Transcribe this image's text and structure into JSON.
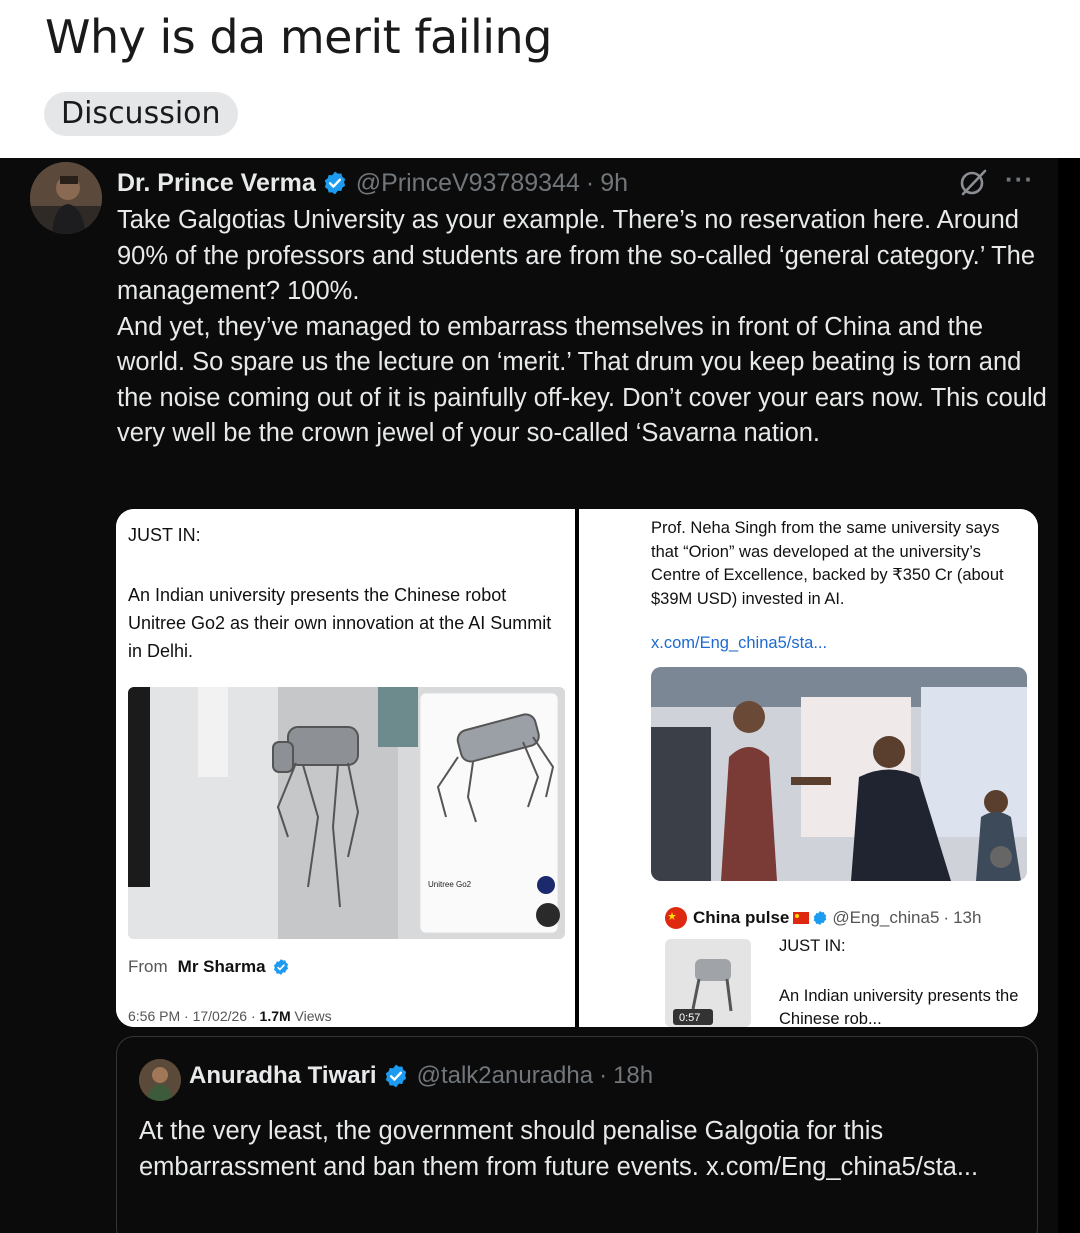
{
  "post": {
    "title": "Why is da merit failing",
    "flair": "Discussion"
  },
  "tweet": {
    "author_name": "Dr. Prince Verma",
    "handle": "@PrinceV93789344",
    "separator": "·",
    "time": "9h",
    "more_label": "···",
    "text_lines": [
      "Take Galgotias University as your example. There’s no reservation here. Around 90% of the professors and students are from the so-called ‘general category.’ The management? 100%.",
      "And yet, they’ve managed to embarrass themselves in front of China and the world. So spare us the lecture on ‘merit.’ That drum you keep beating is torn and the noise coming out of it is painfully off-key. Don’t cover your ears now. This could very well be the crown jewel of your so-called ‘Savarna nation."
    ]
  },
  "media_left": {
    "heading": "JUST IN:",
    "body": "An Indian university presents the Chinese robot Unitree Go2 as their own innovation at the AI Summit in Delhi.",
    "product_label": "Unitree Go2",
    "from_label": "From",
    "from_name": "Mr Sharma",
    "stats_time": "6:56 PM · 17/02/26 · ",
    "stats_views": "1.7M",
    "stats_views_label": " Views"
  },
  "media_right": {
    "body": "Prof. Neha Singh from the same university says that “Orion” was developed at the university’s Centre of Excellence, backed by ₹350 Cr (about $39M USD) invested in AI.",
    "link": "x.com/Eng_china5/sta...",
    "card_name": "China pulse",
    "card_handle": "@Eng_china5",
    "card_sep": "·",
    "card_time": "13h",
    "card_heading": "JUST IN:",
    "card_text": "An Indian university presents the Chinese rob...",
    "video_time": "0:57"
  },
  "quote": {
    "author_name": "Anuradha Tiwari",
    "handle": "@talk2anuradha",
    "separator": "·",
    "time": "18h",
    "text": "At the very least, the government should penalise Galgotia for this embarrassment and ban them from future events. x.com/Eng_china5/sta..."
  },
  "colors": {
    "verified": "#1d9bf0",
    "text_primary": "#e7e9ea",
    "text_secondary": "#71767b",
    "link": "#1d6ad0",
    "flair_bg": "#e5e6e8"
  }
}
